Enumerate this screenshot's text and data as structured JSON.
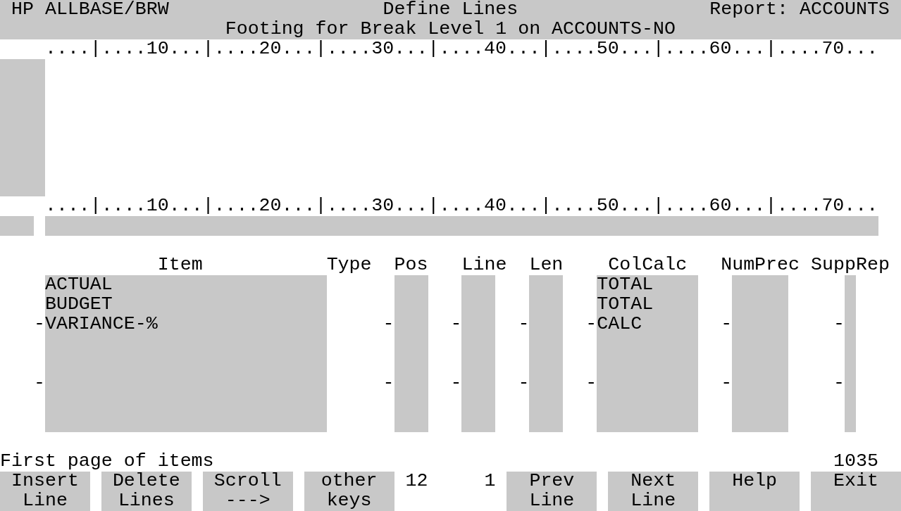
{
  "header": {
    "product": "HP ALLBASE/BRW",
    "screen_title": "Define Lines",
    "report": "Report: ACCOUNTS",
    "subtitle": "Footing for Break Level 1 on ACCOUNTS-NO"
  },
  "rulers": [
    "....|....10...|....20...|....30...|....40...|....50...|....60...|....70...",
    "....|....10...|....20...|....30...|....40...|....50...|....60...|....70..."
  ],
  "item_table": {
    "columns": [
      "Item",
      "Type",
      "Pos",
      "Line",
      "Len",
      "ColCalc",
      "NumPrec",
      "SuppRep"
    ],
    "rows": [
      {
        "item": "ACTUAL",
        "col_calc": "TOTAL"
      },
      {
        "item": "BUDGET",
        "col_calc": "TOTAL"
      },
      {
        "item": "VARIANCE-%",
        "col_calc": "CALC",
        "markers": [
          "-",
          "-",
          "-",
          "-",
          "-",
          "-",
          "-"
        ]
      },
      {},
      {},
      {
        "markers": [
          "-",
          "-",
          "-",
          "-",
          "-",
          "-",
          "-"
        ]
      },
      {},
      {}
    ]
  },
  "message": "First page of items",
  "counter": "1035",
  "softkeys": [
    {
      "kind": "key",
      "lines": [
        "Insert",
        "Line"
      ]
    },
    {
      "kind": "key",
      "lines": [
        "Delete",
        "Lines"
      ]
    },
    {
      "kind": "key",
      "lines": [
        "Scroll",
        "--->"
      ]
    },
    {
      "kind": "key",
      "lines": [
        "other",
        "keys"
      ]
    },
    {
      "kind": "readout",
      "values": [
        "12",
        "1"
      ]
    },
    {
      "kind": "key",
      "lines": [
        "Prev",
        "Line"
      ]
    },
    {
      "kind": "key",
      "lines": [
        "Next",
        "Line"
      ]
    },
    {
      "kind": "key",
      "lines": [
        "Help"
      ]
    },
    {
      "kind": "key",
      "lines": [
        "Exit"
      ]
    }
  ]
}
